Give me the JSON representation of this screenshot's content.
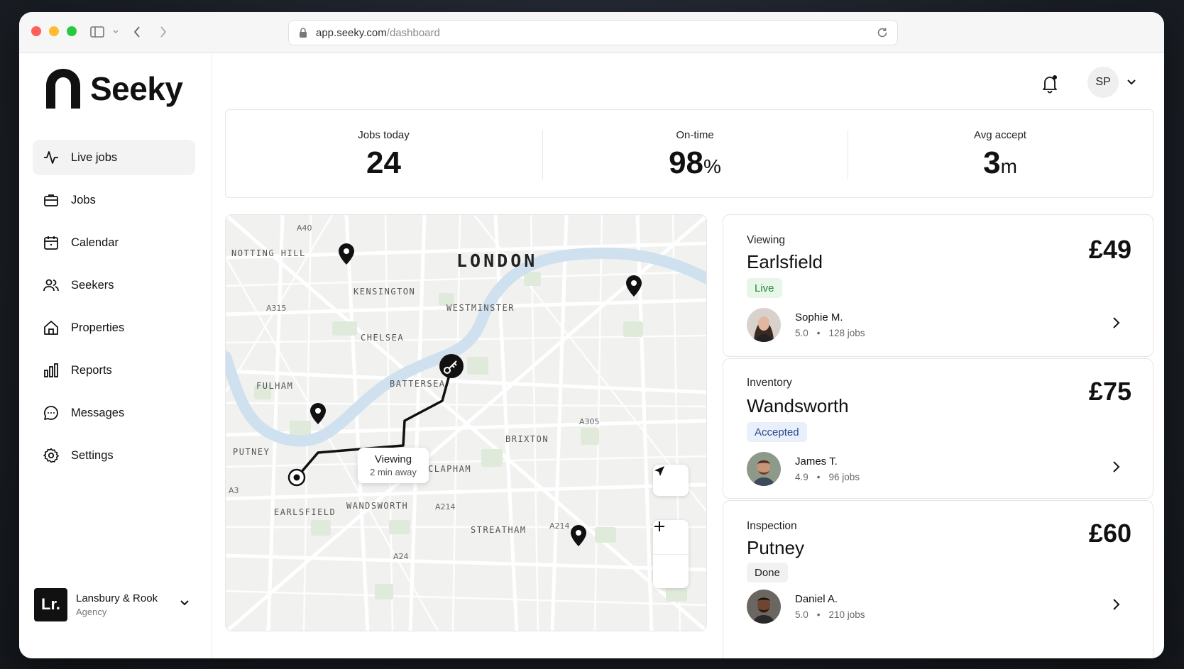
{
  "browser": {
    "url_domain": "app.seeky.com",
    "url_path": "/dashboard"
  },
  "brand": {
    "name": "Seeky"
  },
  "sidebar": {
    "items": [
      {
        "label": "Live jobs",
        "icon": "activity-icon",
        "active": true
      },
      {
        "label": "Jobs",
        "icon": "briefcase-icon"
      },
      {
        "label": "Calendar",
        "icon": "calendar-icon"
      },
      {
        "label": "Seekers",
        "icon": "users-icon"
      },
      {
        "label": "Properties",
        "icon": "home-icon"
      },
      {
        "label": "Reports",
        "icon": "bar-chart-icon"
      },
      {
        "label": "Messages",
        "icon": "message-icon"
      },
      {
        "label": "Settings",
        "icon": "gear-icon"
      }
    ],
    "agency": {
      "logo_text": "Lr.",
      "name": "Lansbury & Rook",
      "type": "Agency"
    }
  },
  "header": {
    "user_initials": "SP"
  },
  "stats": [
    {
      "label": "Jobs today",
      "value": "24",
      "unit": ""
    },
    {
      "label": "On-time",
      "value": "98",
      "unit": "%"
    },
    {
      "label": "Avg accept",
      "value": "3",
      "unit": "m"
    }
  ],
  "map": {
    "city": "LONDON",
    "areas": [
      "NOTTING HILL",
      "KENSINGTON",
      "WESTMINSTER",
      "CHELSEA",
      "FULHAM",
      "BATTERSEA",
      "BRIXTON",
      "PUTNEY",
      "CLAPHAM",
      "EARLSFIELD",
      "WANDSWORTH",
      "STREATHAM"
    ],
    "roads": [
      "A40",
      "A315",
      "A305",
      "A3",
      "A214",
      "A214",
      "A24"
    ],
    "tooltip": {
      "title": "Viewing",
      "subtitle": "2 min away"
    }
  },
  "jobs": [
    {
      "type": "Viewing",
      "place": "Earlsfield",
      "price": "£49",
      "status": "Live",
      "person": "Sophie M.",
      "rating": "5.0",
      "jobs": "128 jobs"
    },
    {
      "type": "Inventory",
      "place": "Wandsworth",
      "price": "£75",
      "status": "Accepted",
      "person": "James T.",
      "rating": "4.9",
      "jobs": "96 jobs"
    },
    {
      "type": "Inspection",
      "place": "Putney",
      "price": "£60",
      "status": "Done",
      "person": "Daniel A.",
      "rating": "5.0",
      "jobs": "210 jobs"
    }
  ],
  "colors": {
    "live_green": "#1d8a34",
    "accepted_blue": "#2a4a8a",
    "river": "#cfe0ee",
    "park": "#dfeadb"
  }
}
